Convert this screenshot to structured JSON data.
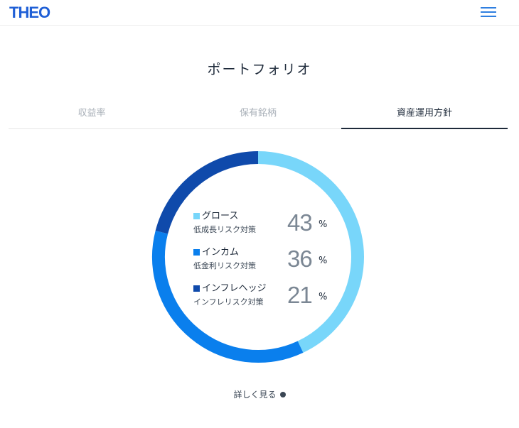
{
  "header": {
    "logo": "THEO",
    "menu_icon": "hamburger-icon"
  },
  "page_title": "ポートフォリオ",
  "tabs": [
    {
      "label": "収益率",
      "active": false
    },
    {
      "label": "保有銘柄",
      "active": false
    },
    {
      "label": "資産運用方針",
      "active": true
    }
  ],
  "chart_data": {
    "type": "pie",
    "categories": [
      "グロース",
      "インカム",
      "インフレヘッジ"
    ],
    "values": [
      43,
      36,
      21
    ],
    "colors": [
      "#78d6fa",
      "#0a7fed",
      "#0f4aab"
    ]
  },
  "legend": [
    {
      "name": "グロース",
      "desc": "低成長リスク対策",
      "value": "43",
      "unit": "%"
    },
    {
      "name": "インカム",
      "desc": "低金利リスク対策",
      "value": "36",
      "unit": "%"
    },
    {
      "name": "インフレヘッジ",
      "desc": "インフレリスク対策",
      "value": "21",
      "unit": "%"
    }
  ],
  "more_link": "詳しく見る",
  "more_icon": "chevron-circle-icon"
}
